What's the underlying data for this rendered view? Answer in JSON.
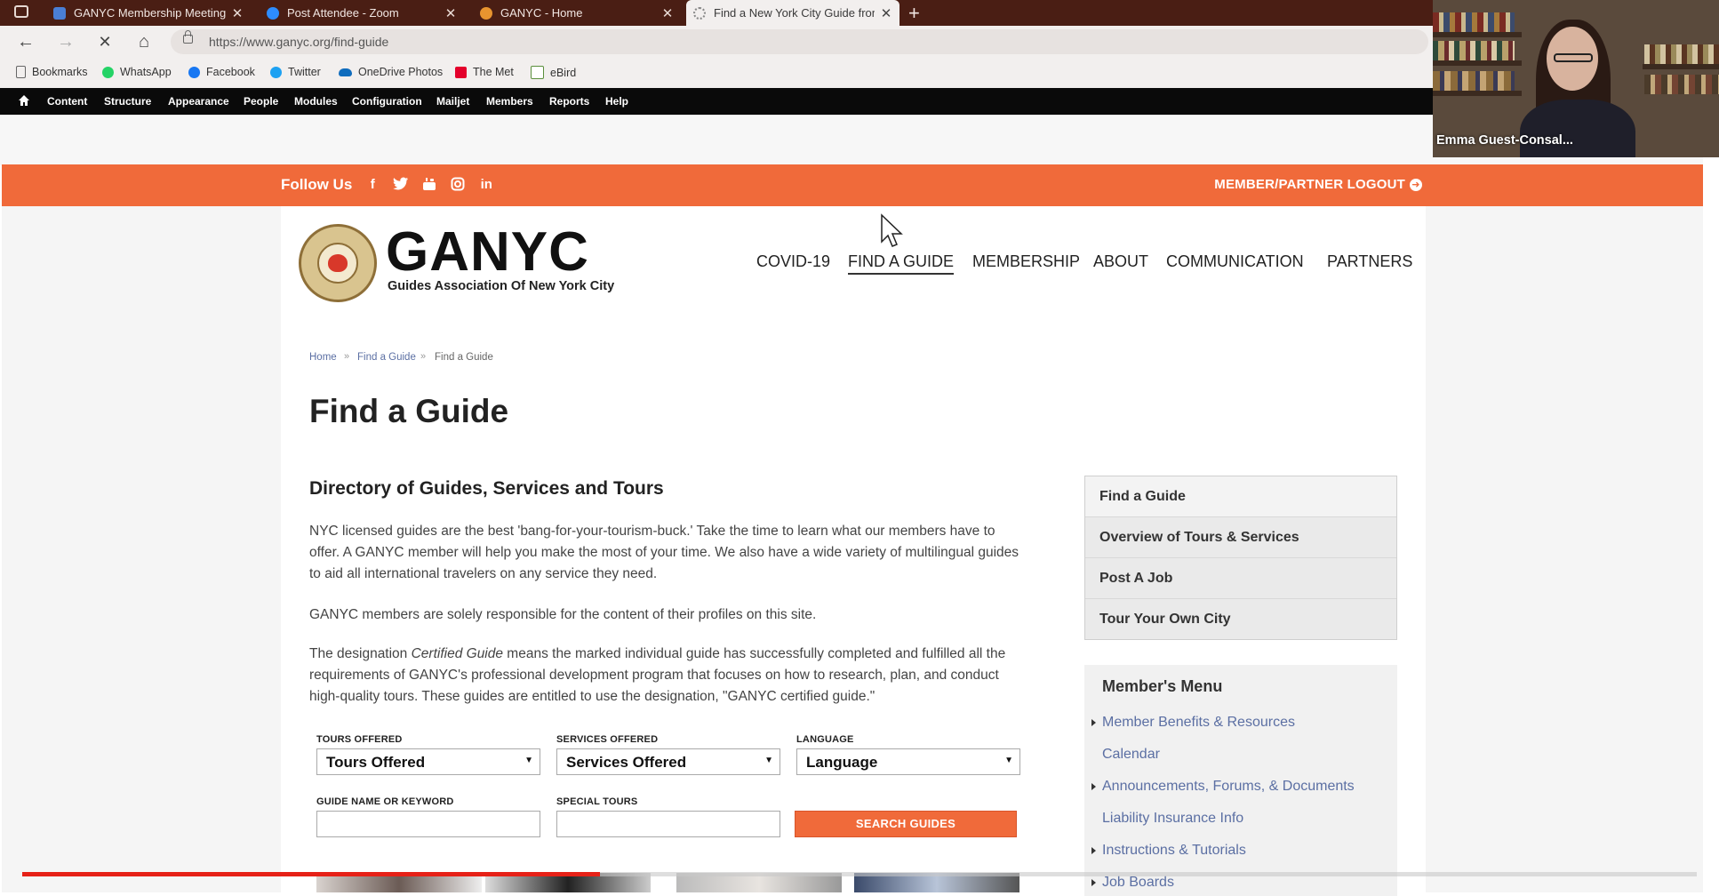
{
  "browser": {
    "tabs": [
      {
        "title": "GANYC Membership Meeting A",
        "favicon_color": "#4a7fd6"
      },
      {
        "title": "Post Attendee - Zoom",
        "favicon_color": "#2d8cff"
      },
      {
        "title": "GANYC - Home",
        "favicon_color": "#e8942f"
      },
      {
        "title": "Find a New York City Guide fron",
        "favicon_color": "#888888",
        "active": true
      }
    ],
    "url": "https://www.ganyc.org/find-guide",
    "bookmarks": [
      {
        "label": "Bookmarks",
        "color": "#666666"
      },
      {
        "label": "WhatsApp",
        "color": "#25d366"
      },
      {
        "label": "Facebook",
        "color": "#1877f2"
      },
      {
        "label": "Twitter",
        "color": "#1da1f2"
      },
      {
        "label": "OneDrive Photos",
        "color": "#0f6cbd"
      },
      {
        "label": "The Met",
        "color": "#e4002b"
      },
      {
        "label": "eBird",
        "color": "#5a8f3c"
      }
    ]
  },
  "admin_toolbar": [
    "Content",
    "Structure",
    "Appearance",
    "People",
    "Modules",
    "Configuration",
    "Mailjet",
    "Members",
    "Reports",
    "Help"
  ],
  "webcam": {
    "name": "Emma Guest-Consal..."
  },
  "site": {
    "follow_label": "Follow Us",
    "social_icons": [
      "facebook-icon",
      "twitter-icon",
      "youtube-icon",
      "instagram-icon",
      "linkedin-icon"
    ],
    "logout_label": "MEMBER/PARTNER LOGOUT",
    "brand": "GANYC",
    "brand_sub": "Guides Association Of New York City",
    "nav": [
      "COVID-19",
      "FIND A GUIDE",
      "MEMBERSHIP",
      "ABOUT",
      "COMMUNICATION",
      "PARTNERS"
    ],
    "nav_active": "FIND A GUIDE",
    "breadcrumb": [
      "Home",
      "Find a Guide",
      "Find a Guide"
    ],
    "title": "Find a Guide",
    "subtitle": "Directory of Guides, Services and Tours",
    "para1": "NYC licensed guides are the best 'bang-for-your-tourism-buck.' Take the time to learn what our members have to offer. A GANYC member will help you make the most of your time. We also have a wide variety of multilingual guides to aid all international travelers on any service they need.",
    "para2": "GANYC members are solely responsible for the content of their profiles on this site.",
    "para3_pre": "The designation ",
    "para3_em": "Certified Guide",
    "para3_post": " means the marked individual guide has successfully completed and fulfilled all the requirements of GANYC's professional development program that focuses on how to research, plan, and conduct high-quality tours. These guides are entitled to use the designation, \"GANYC certified guide.\"",
    "filters": {
      "tours_label": "TOURS OFFERED",
      "tours_value": "Tours Offered",
      "services_label": "SERVICES OFFERED",
      "services_value": "Services Offered",
      "language_label": "LANGUAGE",
      "language_value": "Language",
      "keyword_label": "GUIDE NAME OR KEYWORD",
      "keyword_value": "",
      "special_label": "SPECIAL TOURS",
      "special_value": "",
      "search_button": "SEARCH GUIDES"
    },
    "sidebar": [
      "Find a Guide",
      "Overview of Tours & Services",
      "Post A Job",
      "Tour Your Own City"
    ],
    "member_menu": {
      "title": "Member's Menu",
      "items": [
        {
          "label": "Member Benefits & Resources",
          "expandable": true
        },
        {
          "label": "Calendar",
          "expandable": false
        },
        {
          "label": "Announcements, Forums, & Documents",
          "expandable": true
        },
        {
          "label": "Liability Insurance Info",
          "expandable": false
        },
        {
          "label": "Instructions & Tutorials",
          "expandable": true
        },
        {
          "label": "Job Boards",
          "expandable": true
        }
      ]
    }
  },
  "video": {
    "progress_percent": 34.5
  },
  "colors": {
    "accent": "#f06a3a",
    "link": "#5b6fa3",
    "tabbar": "#4a1e14"
  }
}
